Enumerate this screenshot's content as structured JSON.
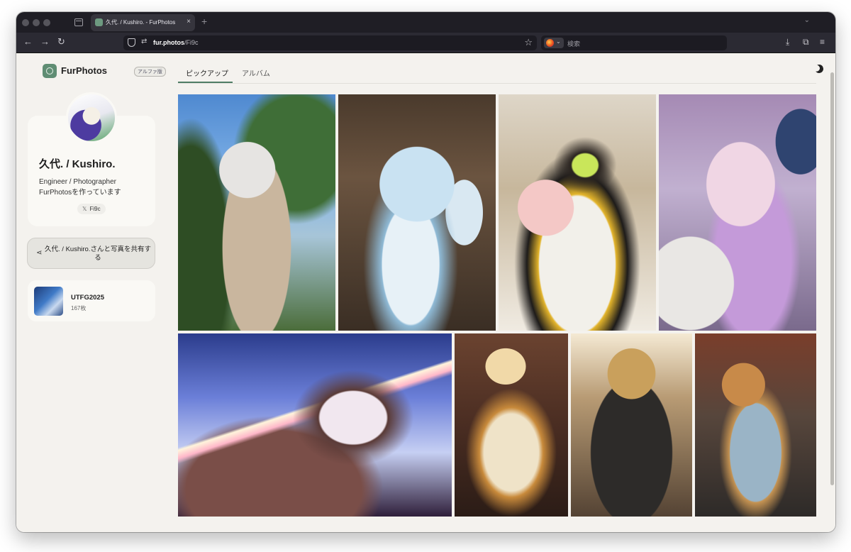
{
  "browser": {
    "tab_title": "久代. / Kushiro. - FurPhotos",
    "tab_close": "×",
    "new_tab": "+",
    "url_host": "fur.photos",
    "url_path": "/Fi9c",
    "search_placeholder": "検索",
    "icons": {
      "back": "arrow-left-icon",
      "forward": "arrow-right-icon",
      "reload": "reload-icon",
      "bookmark": "star-icon",
      "downloads": "download-icon",
      "extensions": "puzzle-icon",
      "menu": "hamburger-icon"
    }
  },
  "site": {
    "brand": "FurPhotos",
    "badge": "アルファ版",
    "accent_color": "#4f7d66"
  },
  "profile": {
    "name": "久代. / Kushiro.",
    "bio_line1": "Engineer / Photographer",
    "bio_line2": "FurPhotosを作っています",
    "x_icon": "𝕏",
    "x_handle": "Fi9c",
    "share_label": "久代. / Kushiro.さんと写真を共有する"
  },
  "album": {
    "title": "UTFG2025",
    "count": "167枚"
  },
  "nav": {
    "tabs": [
      {
        "label": "ピックアップ",
        "active": true
      },
      {
        "label": "アルバム",
        "active": false
      }
    ]
  }
}
